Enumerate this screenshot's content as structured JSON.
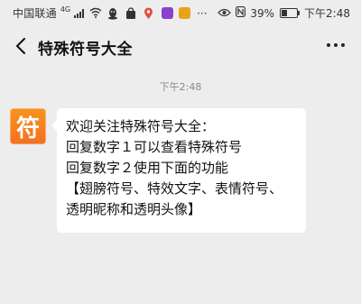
{
  "status_bar": {
    "carrier": "中国联通",
    "network": "4G",
    "battery_percent": "39%",
    "battery_level": 0.39,
    "time": "下午2:48",
    "icons": [
      "signal-icon",
      "wifi-icon",
      "penguin-icon",
      "bag-icon",
      "location-pin-icon",
      "app-badge-purple",
      "app-badge-red",
      "more-dots",
      "eye-icon",
      "nfc-icon",
      "battery-icon"
    ]
  },
  "header": {
    "title": "特殊符号大全"
  },
  "chat": {
    "timestamp": "下午2:48",
    "avatar_char": "符",
    "message_lines": [
      "欢迎关注特殊符号大全：",
      "回复数字１可以查看特殊符号",
      "回复数字２使用下面的功能",
      "【翅膀符号、特效文字、表情符号、",
      "透明昵称和透明头像】"
    ]
  },
  "colors": {
    "background": "#ededed",
    "bubble": "#ffffff",
    "avatar": "#f37021",
    "timestamp": "#8a8a8a"
  }
}
